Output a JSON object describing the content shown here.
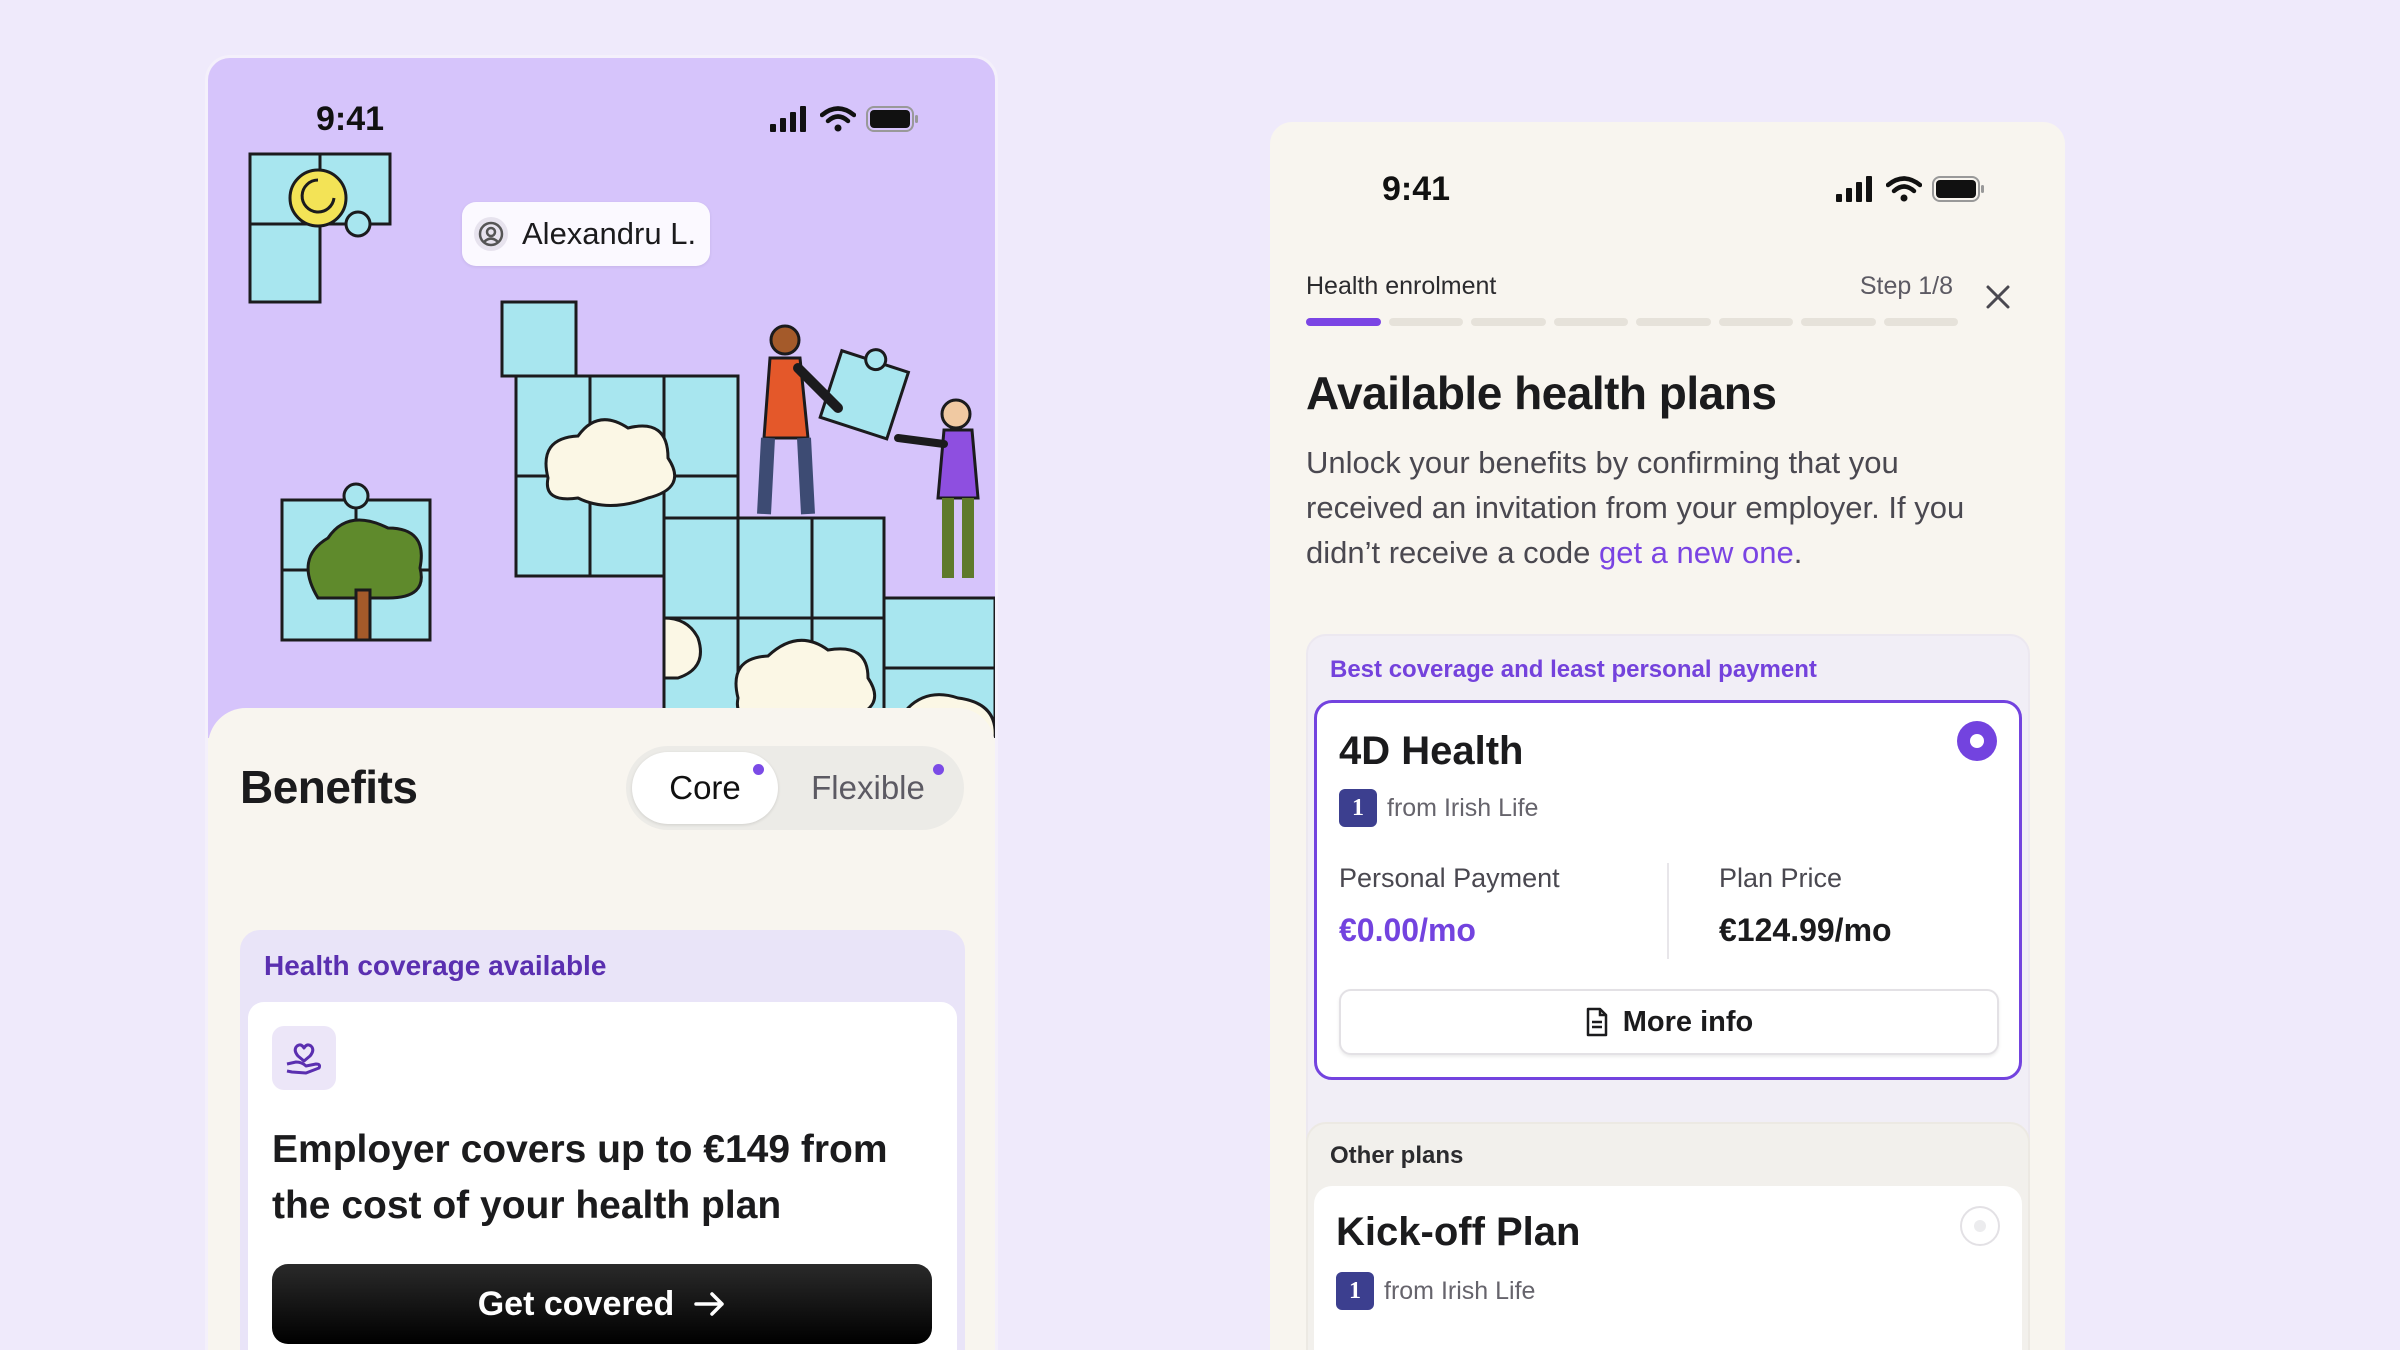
{
  "left_phone": {
    "status_time": "9:41",
    "user_name": "Alexandru L.",
    "benefits_title": "Benefits",
    "segments": [
      {
        "label": "Core",
        "active": true
      },
      {
        "label": "Flexible",
        "active": false
      }
    ],
    "coverage": {
      "label": "Health coverage available",
      "icon": "hand-heart-icon",
      "headline": "Employer covers up to €149 from the cost of your health plan",
      "cta_label": "Get covered"
    }
  },
  "right_phone": {
    "status_time": "9:41",
    "flow_label": "Health enrolment",
    "step_label": "Step 1/8",
    "progress": {
      "current": 1,
      "total": 8
    },
    "title": "Available health plans",
    "description_prefix": "Unlock your benefits by confirming that you received an invitation from your employer. If you didn’t receive a code ",
    "description_link": "get a new one",
    "description_suffix": ".",
    "best_section": {
      "label": "Best coverage and least personal payment",
      "plan": {
        "name": "4D Health",
        "provider": "from Irish Life",
        "provider_logo": "irish-life-logo",
        "selected": true,
        "personal_payment_label": "Personal Payment",
        "personal_payment_value": "€0.00/mo",
        "plan_price_label": "Plan Price",
        "plan_price_value": "€124.99/mo",
        "more_info_label": "More info"
      }
    },
    "other_section": {
      "label": "Other plans",
      "plan": {
        "name": "Kick-off Plan",
        "provider": "from Irish Life",
        "selected": false
      }
    }
  },
  "colors": {
    "background": "#efeafb",
    "hero": "#d6c4fb",
    "accent_purple": "#7343df",
    "sheet": "#f8f5ef",
    "puzzle": "#a8e6ef"
  }
}
